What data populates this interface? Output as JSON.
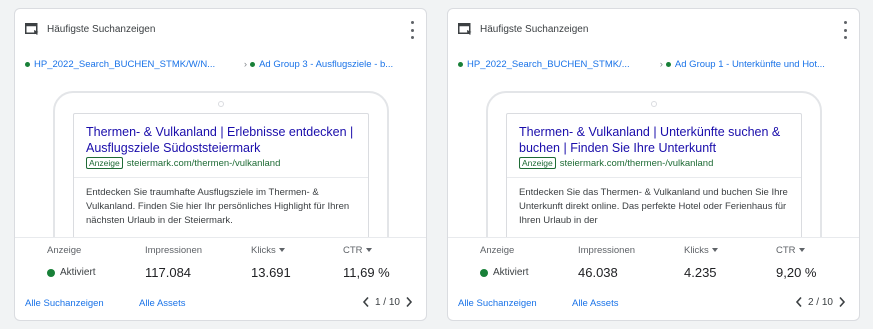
{
  "colors": {
    "link": "#1a73e8",
    "ad_title": "#1a0dab",
    "ad_url": "#1e6b35",
    "status_green": "#188038"
  },
  "cards": [
    {
      "header_title": "Häufigste Suchanzeigen",
      "header_icon": "ad-preview-icon",
      "menu_icon": "more-vert-icon",
      "campaign": "HP_2022_Search_BUCHEN_STMK/W/N...",
      "ad_group": "Ad Group 3 - Ausflugsziele - b...",
      "ad": {
        "title": "Thermen- & Vulkanland | Erlebnisse entdecken | Ausflugsziele Südoststeiermark",
        "badge": "Anzeige",
        "url": "steiermark.com/thermen-/vulkanland",
        "description": "Entdecken Sie traumhafte Ausflugsziele im Thermen- & Vulkanland. Finden Sie hier Ihr persönliches Highlight für Ihren nächsten Urlaub in der Steiermark."
      },
      "stats": {
        "status_label": "Anzeige",
        "status_value": "Aktiviert",
        "impressions_label": "Impressionen",
        "impressions_value": "117.084",
        "clicks_label": "Klicks",
        "clicks_value": "13.691",
        "ctr_label": "CTR",
        "ctr_value": "11,69 %"
      },
      "footer": {
        "all_ads": "Alle Suchanzeigen",
        "all_assets": "Alle Assets",
        "page": "1 / 10"
      }
    },
    {
      "header_title": "Häufigste Suchanzeigen",
      "header_icon": "ad-preview-icon",
      "menu_icon": "more-vert-icon",
      "campaign": "HP_2022_Search_BUCHEN_STMK/...",
      "ad_group": "Ad Group 1 - Unterkünfte und Hot...",
      "ad": {
        "title": "Thermen- & Vulkanland | Unterkünfte suchen & buchen | Finden Sie Ihre Unterkunft",
        "badge": "Anzeige",
        "url": "steiermark.com/thermen-/vulkanland",
        "description": "Entdecken Sie das Thermen- & Vulkanland und buchen Sie Ihre Unterkunft direkt online. Das perfekte Hotel oder Ferienhaus für Ihren Urlaub in der"
      },
      "stats": {
        "status_label": "Anzeige",
        "status_value": "Aktiviert",
        "impressions_label": "Impressionen",
        "impressions_value": "46.038",
        "clicks_label": "Klicks",
        "clicks_value": "4.235",
        "ctr_label": "CTR",
        "ctr_value": "9,20 %"
      },
      "footer": {
        "all_ads": "Alle Suchanzeigen",
        "all_assets": "Alle Assets",
        "page": "2 / 10"
      }
    }
  ]
}
